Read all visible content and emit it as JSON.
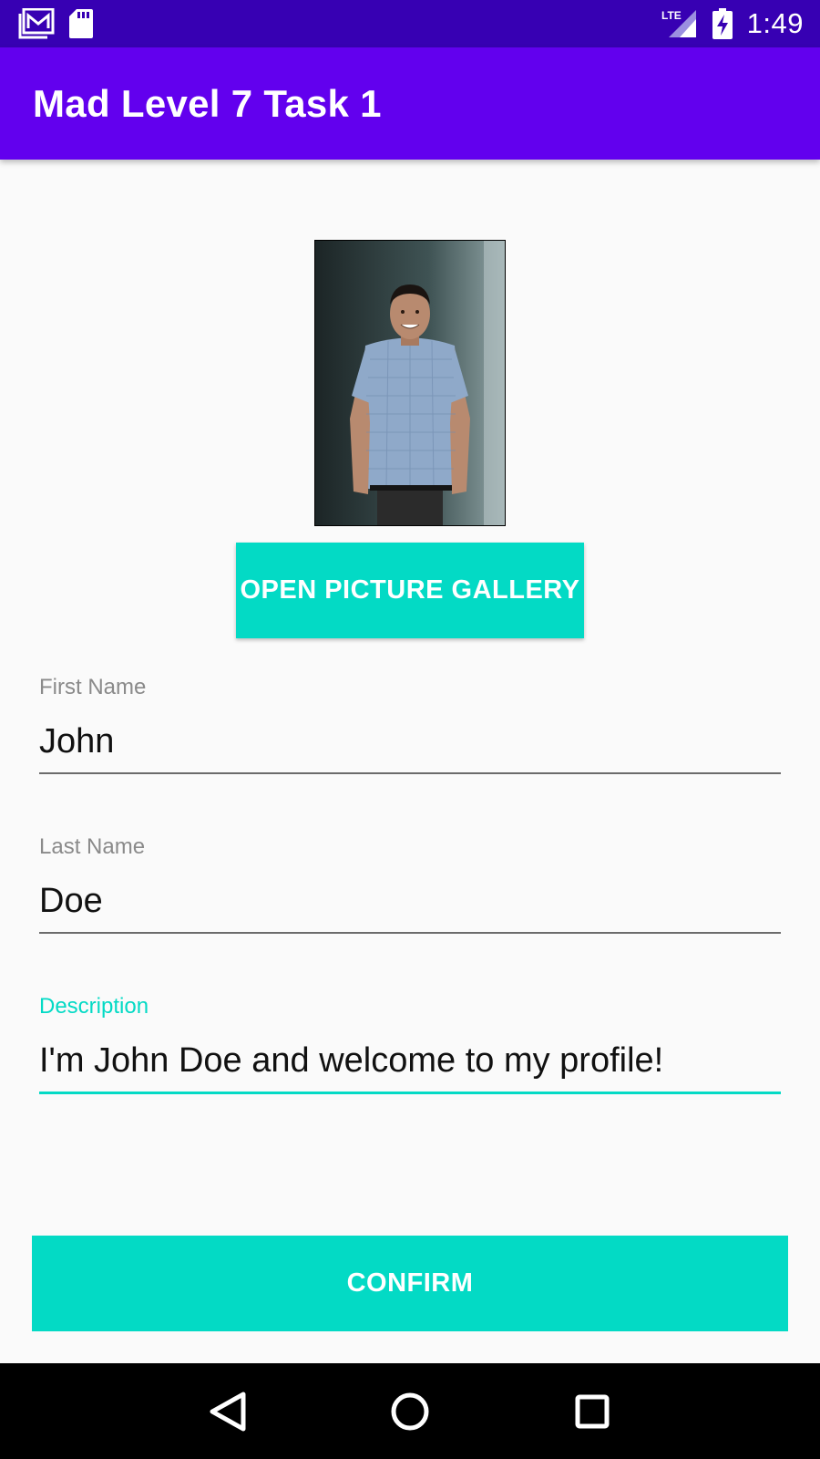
{
  "status_bar": {
    "time": "1:49",
    "left_icons": [
      "gallery-notification-icon",
      "sd-card-icon"
    ],
    "right_icons": [
      "lte-signal-icon",
      "battery-charging-icon"
    ],
    "network_label": "LTE",
    "background": "#3700b3"
  },
  "app_bar": {
    "title": "Mad Level 7 Task 1",
    "background": "#6200ee"
  },
  "profile": {
    "photo_description_icon": "profile-photo",
    "gallery_button_label": "OPEN PICTURE GALLERY"
  },
  "form": {
    "first_name": {
      "label": "First Name",
      "value": "John"
    },
    "last_name": {
      "label": "Last Name",
      "value": "Doe"
    },
    "description": {
      "label": "Description",
      "value": "I'm John Doe and welcome to my profile!",
      "focused": true
    }
  },
  "confirm_button_label": "CONFIRM",
  "accent_color": "#03dac5",
  "nav_bar": {
    "buttons": [
      "back-icon",
      "home-icon",
      "recents-icon"
    ]
  }
}
